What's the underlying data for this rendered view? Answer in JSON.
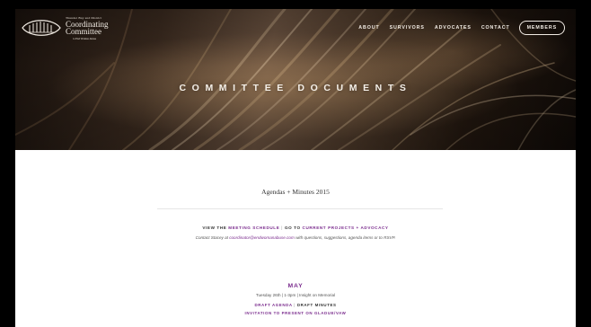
{
  "logo": {
    "small_line": "Thunder Bay and District",
    "line1": "Coordinating",
    "line2": "Committee",
    "tagline": "to End Woman Abuse"
  },
  "nav": {
    "about": "ABOUT",
    "survivors": "SURVIVORS",
    "advocates": "ADVOCATES",
    "contact": "CONTACT",
    "members": "MEMBERS"
  },
  "hero": {
    "title": "COMMITTEE DOCUMENTS"
  },
  "content": {
    "subhead": "Agendas + Minutes 2015",
    "view_prefix": "VIEW THE ",
    "meeting_schedule_link": "MEETING SCHEDULE",
    "separator": "|",
    "goto_prefix": "GO TO ",
    "current_projects_link": "CURRENT PROJECTS + ADVOCACY",
    "contact_prefix": "Contact Stacey at ",
    "contact_email": "coordinator@endwomanabuse.com",
    "contact_suffix": " with questions, suggestions, agenda items or to RSVP."
  },
  "section": {
    "month": "MAY",
    "meeting": "Tuesday 26th | 1-3pm | Insight on Memorial",
    "draft_agenda": "DRAFT AGENDA",
    "draft_minutes": "DRAFT MINUTES",
    "invitation": "INVITATION TO PRESENT ON GLADUE/VAW"
  },
  "colors": {
    "accent": "#7b2d8e",
    "page_bg": "#000000",
    "content_bg": "#ffffff"
  }
}
